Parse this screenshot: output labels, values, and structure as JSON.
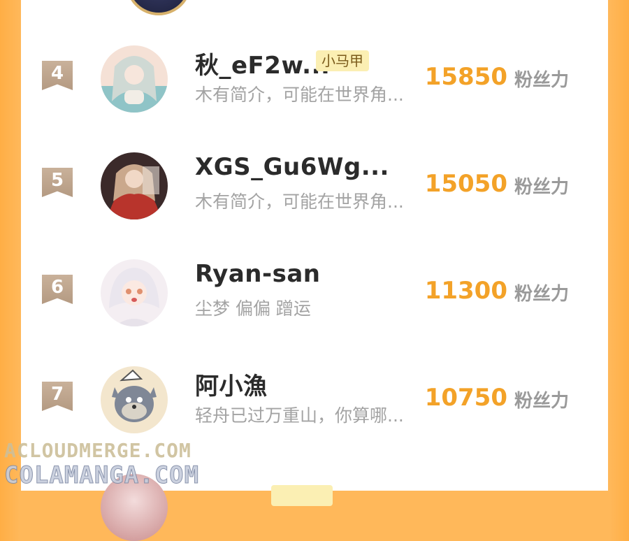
{
  "ranking": {
    "rows": [
      {
        "rank": "4",
        "name": "秋_eF2w...",
        "tag": "小马甲",
        "bio": "木有简介，可能在世界角...",
        "score": "15850",
        "unit": "粉丝力",
        "avatar_icon": "avatar-illustration-mermaid"
      },
      {
        "rank": "5",
        "name": "XGS_Gu6Wg...",
        "tag": "",
        "bio": "木有简介，可能在世界角...",
        "score": "15050",
        "unit": "粉丝力",
        "avatar_icon": "avatar-illustration-girl-red"
      },
      {
        "rank": "6",
        "name": "Ryan-san",
        "tag": "",
        "bio": "尘梦 偏偏 蹭运",
        "score": "11300",
        "unit": "粉丝力",
        "avatar_icon": "avatar-illustration-white-hair"
      },
      {
        "rank": "7",
        "name": "阿小漁",
        "tag": "",
        "bio": "轻舟已过万重山，你算哪...",
        "score": "10750",
        "unit": "粉丝力",
        "avatar_icon": "avatar-cartoon-cat"
      }
    ]
  },
  "watermark": {
    "line1": "ACLOUDMERGE.COM",
    "line2": "COLAMANGA.COM"
  },
  "colors": {
    "accent_score": "#f3a228",
    "background_orange": "#ffb85a",
    "rank_badge": "#c9b19a",
    "tag_bg": "#fbefb3"
  }
}
